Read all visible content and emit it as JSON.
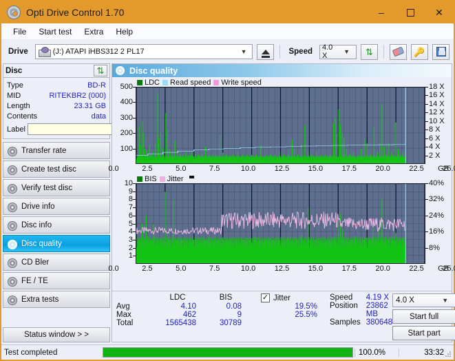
{
  "window": {
    "title": "Opti Drive Control 1.70",
    "icon": "disc-icon",
    "controls": {
      "minimize": "–",
      "maximize": "□",
      "close": "✕"
    }
  },
  "menu": {
    "items": [
      "File",
      "Start test",
      "Extra",
      "Help"
    ]
  },
  "toolbar": {
    "drive_label": "Drive",
    "drive_value": "(J:)  ATAPI iHBS312  2 PL17",
    "eject_icon": "eject-icon",
    "speed_label": "Speed",
    "speed_value": "4.0 X",
    "refresh_icon": "refresh-icon",
    "eraser_icon": "eraser-icon",
    "key_icon": "key-icon",
    "save_icon": "save-icon"
  },
  "disc_panel": {
    "title": "Disc",
    "refresh_icon": "refresh-icon",
    "rows": [
      {
        "key": "Type",
        "value": "BD-R"
      },
      {
        "key": "MID",
        "value": "RITEKBR2 (000)"
      },
      {
        "key": "Length",
        "value": "23.31 GB"
      },
      {
        "key": "Contents",
        "value": "data"
      }
    ],
    "label_key": "Label",
    "label_value": "",
    "label_placeholder": "",
    "label_button_icon": "cd-icon"
  },
  "sidebar": {
    "items": [
      {
        "label": "Transfer rate",
        "icon": "disc-icon",
        "active": false
      },
      {
        "label": "Create test disc",
        "icon": "disc-icon",
        "active": false
      },
      {
        "label": "Verify test disc",
        "icon": "disc-icon",
        "active": false
      },
      {
        "label": "Drive info",
        "icon": "disc-icon",
        "active": false
      },
      {
        "label": "Disc info",
        "icon": "disc-icon",
        "active": false
      },
      {
        "label": "Disc quality",
        "icon": "disc-icon",
        "active": true
      },
      {
        "label": "CD Bler",
        "icon": "disc-icon",
        "active": false
      },
      {
        "label": "FE / TE",
        "icon": "disc-icon",
        "active": false
      },
      {
        "label": "Extra tests",
        "icon": "disc-icon",
        "active": false
      }
    ],
    "status_window": "Status window > >"
  },
  "panel": {
    "header_title": "Disc quality",
    "header_icon": "disc-icon"
  },
  "stats": {
    "col_headers": [
      "LDC",
      "BIS"
    ],
    "rows": [
      {
        "key": "Avg",
        "ldc": "4.10",
        "bis": "0.08",
        "jitter": "19.5%"
      },
      {
        "key": "Max",
        "ldc": "462",
        "bis": "9",
        "jitter": "25.5%"
      },
      {
        "key": "Total",
        "ldc": "1565438",
        "bis": "30789",
        "jitter": ""
      }
    ],
    "jitter_label": "Jitter",
    "jitter_checked": true,
    "checkmark": "✓",
    "speed_key": "Speed",
    "speed_value": "4.19 X",
    "position_key": "Position",
    "position_value": "23862 MB",
    "samples_key": "Samples",
    "samples_value": "380648",
    "speed_select": "4.0 X",
    "start_full": "Start full",
    "start_part": "Start part"
  },
  "statusbar": {
    "text": "Test completed",
    "progress_percent": "100.0%",
    "progress_value": 100,
    "elapsed": "33:32"
  },
  "chart_data": [
    {
      "type": "line",
      "title": "LDC / Read speed",
      "xlabel": "GB",
      "ylabel": "LDC",
      "xlim": [
        0,
        25.0
      ],
      "ylim": [
        0,
        500
      ],
      "y2lim": [
        0,
        18
      ],
      "y2label": "X",
      "grid": true,
      "legend_position": "top-left",
      "xticks": [
        "0.0",
        "2.5",
        "5.0",
        "7.5",
        "10.0",
        "12.5",
        "15.0",
        "17.5",
        "20.0",
        "22.5",
        "25.0"
      ],
      "xunit": "GB",
      "yticks": [
        100,
        200,
        300,
        400,
        500
      ],
      "y2ticks": [
        "2 X",
        "4 X",
        "6 X",
        "8 X",
        "10 X",
        "12 X",
        "14 X",
        "16 X",
        "18 X"
      ],
      "series": [
        {
          "name": "LDC",
          "color": "#14c414",
          "kind": "bars",
          "spikes": [
            [
              0.25,
              240
            ],
            [
              0.4,
              120
            ],
            [
              0.55,
              275
            ],
            [
              0.6,
              200
            ],
            [
              0.75,
              95
            ],
            [
              0.95,
              85
            ],
            [
              1.15,
              120
            ],
            [
              1.3,
              60
            ],
            [
              1.45,
              80
            ],
            [
              1.65,
              130
            ],
            [
              1.85,
              465
            ],
            [
              1.95,
              165
            ],
            [
              2.1,
              205
            ],
            [
              2.3,
              100
            ],
            [
              2.55,
              330
            ],
            [
              2.7,
              220
            ],
            [
              2.9,
              90
            ],
            [
              3.1,
              70
            ],
            [
              3.35,
              150
            ],
            [
              3.55,
              80
            ],
            [
              3.8,
              65
            ],
            [
              4.05,
              60
            ],
            [
              4.3,
              75
            ],
            [
              4.55,
              55
            ],
            [
              4.8,
              70
            ],
            [
              5.1,
              60
            ],
            [
              5.4,
              55
            ],
            [
              5.7,
              65
            ],
            [
              6.0,
              110
            ],
            [
              6.3,
              60
            ],
            [
              6.6,
              55
            ],
            [
              6.9,
              60
            ],
            [
              7.25,
              185
            ],
            [
              7.5,
              70
            ],
            [
              7.8,
              60
            ],
            [
              8.1,
              55
            ],
            [
              8.4,
              60
            ],
            [
              8.8,
              70
            ],
            [
              9.2,
              55
            ],
            [
              9.6,
              60
            ],
            [
              10.0,
              55
            ],
            [
              10.4,
              60
            ],
            [
              10.8,
              120
            ],
            [
              11.2,
              55
            ],
            [
              11.6,
              60
            ],
            [
              12.0,
              55
            ],
            [
              12.4,
              75
            ],
            [
              12.8,
              60
            ],
            [
              13.2,
              65
            ],
            [
              13.5,
              155
            ],
            [
              13.7,
              95
            ],
            [
              14.0,
              60
            ],
            [
              14.3,
              125
            ],
            [
              14.6,
              250
            ],
            [
              14.9,
              75
            ],
            [
              15.2,
              60
            ],
            [
              15.6,
              70
            ],
            [
              16.0,
              55
            ],
            [
              16.4,
              60
            ],
            [
              16.8,
              65
            ],
            [
              17.1,
              265
            ],
            [
              17.25,
              300
            ],
            [
              17.4,
              195
            ],
            [
              17.55,
              355
            ],
            [
              17.7,
              255
            ],
            [
              17.85,
              200
            ],
            [
              18.0,
              170
            ],
            [
              18.2,
              95
            ],
            [
              18.5,
              60
            ],
            [
              18.8,
              70
            ],
            [
              19.2,
              55
            ],
            [
              19.5,
              95
            ],
            [
              19.8,
              160
            ],
            [
              20.0,
              130
            ],
            [
              20.3,
              60
            ],
            [
              20.6,
              240
            ],
            [
              20.9,
              70
            ],
            [
              21.1,
              130
            ],
            [
              21.3,
              390
            ],
            [
              21.5,
              110
            ],
            [
              21.7,
              60
            ],
            [
              21.9,
              130
            ],
            [
              22.1,
              70
            ],
            [
              22.3,
              55
            ],
            [
              22.5,
              270
            ],
            [
              22.7,
              95
            ],
            [
              22.9,
              60
            ],
            [
              23.1,
              70
            ]
          ],
          "baseline": 30
        },
        {
          "name": "Read speed",
          "color": "#9bdcf5",
          "kind": "step",
          "points": [
            [
              0.0,
              1.9
            ],
            [
              1.0,
              2.2
            ],
            [
              2.3,
              2.6
            ],
            [
              3.6,
              2.9
            ],
            [
              5.0,
              3.2
            ],
            [
              6.3,
              3.4
            ],
            [
              7.6,
              3.5
            ],
            [
              9.0,
              3.7
            ],
            [
              10.3,
              3.8
            ],
            [
              11.6,
              3.9
            ],
            [
              13.0,
              4.0
            ],
            [
              14.3,
              4.1
            ],
            [
              15.6,
              4.2
            ],
            [
              17.0,
              4.25
            ],
            [
              18.3,
              4.3
            ],
            [
              19.6,
              4.35
            ],
            [
              21.0,
              4.4
            ],
            [
              22.3,
              4.45
            ],
            [
              23.3,
              4.5
            ],
            [
              23.35,
              18.0
            ]
          ]
        },
        {
          "name": "Write speed",
          "color": "#f49ad8",
          "kind": "line",
          "points": []
        }
      ]
    },
    {
      "type": "line",
      "title": "BIS / Jitter",
      "xlabel": "GB",
      "ylabel": "BIS",
      "xlim": [
        0,
        25.0
      ],
      "ylim": [
        0,
        10
      ],
      "y2lim": [
        0,
        40
      ],
      "y2label": "%",
      "grid": true,
      "legend_position": "top-left",
      "xticks": [
        "0.0",
        "2.5",
        "5.0",
        "7.5",
        "10.0",
        "12.5",
        "15.0",
        "17.5",
        "20.0",
        "22.5",
        "25.0"
      ],
      "xunit": "GB",
      "yticks": [
        1,
        2,
        3,
        4,
        5,
        6,
        7,
        8,
        9,
        10
      ],
      "y2ticks": [
        "8%",
        "16%",
        "24%",
        "32%",
        "40%"
      ],
      "series": [
        {
          "name": "BIS",
          "color": "#14c414",
          "kind": "bars",
          "baseline": 2,
          "spikes": [
            [
              0.3,
              3.0
            ],
            [
              0.5,
              5.0
            ],
            [
              0.7,
              3.2
            ],
            [
              0.85,
              6.0
            ],
            [
              1.0,
              3.4
            ],
            [
              1.2,
              3.0
            ],
            [
              1.5,
              4.9
            ],
            [
              1.8,
              2.8
            ],
            [
              2.1,
              3.1
            ],
            [
              2.5,
              9.0
            ],
            [
              2.8,
              3.0
            ],
            [
              3.2,
              8.0
            ],
            [
              3.5,
              2.9
            ],
            [
              3.9,
              3.1
            ],
            [
              4.3,
              2.8
            ],
            [
              4.7,
              3.0
            ],
            [
              5.1,
              2.9
            ],
            [
              5.5,
              2.8
            ],
            [
              5.9,
              3.0
            ],
            [
              6.3,
              3.3
            ],
            [
              6.7,
              2.9
            ],
            [
              7.1,
              2.8
            ],
            [
              7.5,
              3.0
            ],
            [
              7.9,
              2.9
            ],
            [
              8.3,
              2.8
            ],
            [
              8.7,
              3.0
            ],
            [
              9.1,
              2.9
            ],
            [
              9.5,
              2.8
            ],
            [
              9.9,
              3.0
            ],
            [
              10.3,
              3.3
            ],
            [
              10.7,
              2.8
            ],
            [
              11.1,
              2.9
            ],
            [
              11.5,
              3.0
            ],
            [
              11.9,
              2.8
            ],
            [
              12.3,
              2.9
            ],
            [
              12.7,
              3.0
            ],
            [
              13.1,
              3.3
            ],
            [
              13.5,
              2.9
            ],
            [
              13.9,
              3.0
            ],
            [
              14.3,
              3.6
            ],
            [
              14.6,
              3.1
            ],
            [
              14.9,
              7.0
            ],
            [
              15.2,
              2.9
            ],
            [
              15.6,
              3.0
            ],
            [
              16.0,
              2.9
            ],
            [
              16.4,
              3.0
            ],
            [
              16.8,
              2.9
            ],
            [
              17.2,
              3.4
            ],
            [
              17.5,
              5.5
            ],
            [
              17.7,
              6.2
            ],
            [
              17.9,
              4.3
            ],
            [
              18.2,
              3.2
            ],
            [
              18.6,
              3.0
            ],
            [
              19.0,
              3.4
            ],
            [
              19.4,
              3.0
            ],
            [
              19.8,
              3.3
            ],
            [
              20.2,
              3.0
            ],
            [
              20.5,
              4.6
            ],
            [
              20.8,
              3.3
            ],
            [
              21.0,
              4.2
            ],
            [
              21.3,
              8.1
            ],
            [
              21.6,
              3.4
            ],
            [
              21.9,
              3.0
            ],
            [
              22.2,
              3.3
            ],
            [
              22.5,
              3.8
            ],
            [
              22.8,
              3.0
            ],
            [
              23.1,
              3.2
            ]
          ]
        },
        {
          "name": "Jitter",
          "color": "#e8b6e0",
          "kind": "noise-band",
          "segments": [
            {
              "from": 0.0,
              "to": 7.4,
              "center": 4.1,
              "amplitude": 0.45
            },
            {
              "from": 7.4,
              "to": 17.5,
              "center": 5.4,
              "amplitude": 1.1
            },
            {
              "from": 17.5,
              "to": 23.3,
              "center": 4.9,
              "amplitude": 0.9
            }
          ]
        }
      ]
    }
  ]
}
